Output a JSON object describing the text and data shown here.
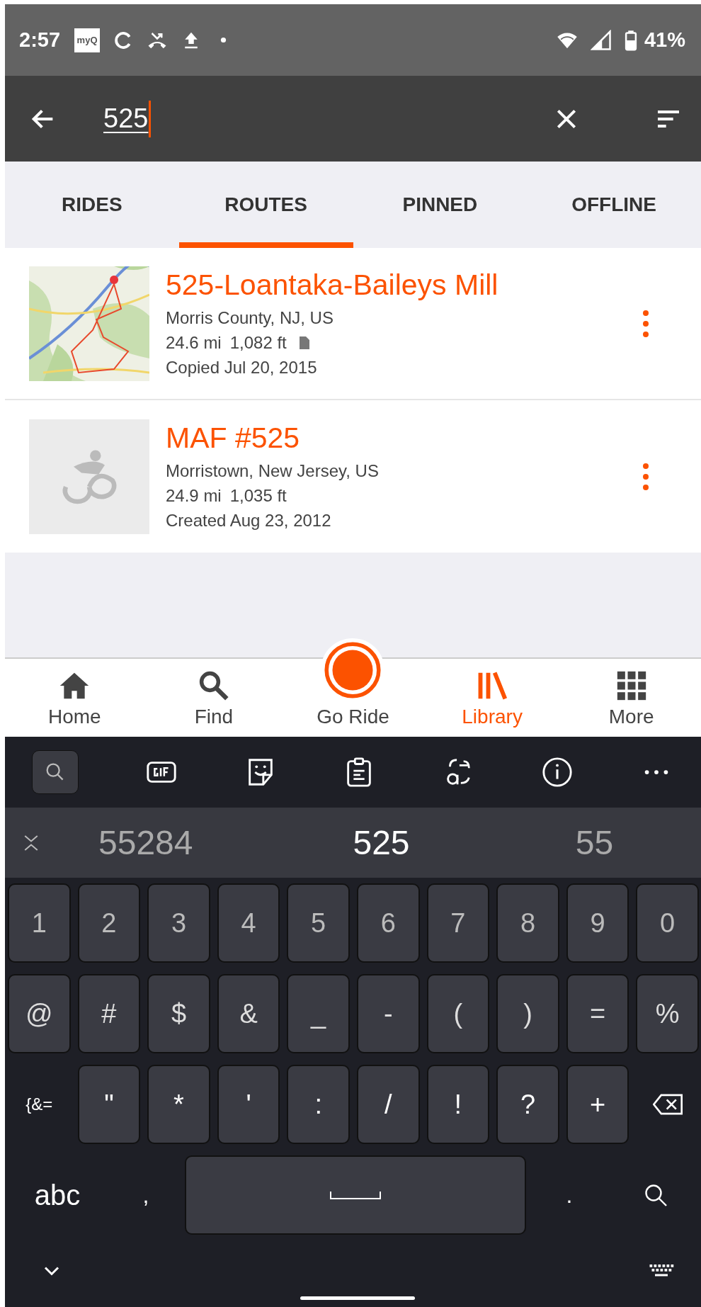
{
  "status_bar": {
    "time": "2:57",
    "app_badge": "myQ",
    "battery": "41%"
  },
  "search": {
    "value": "525"
  },
  "tabs": [
    {
      "label": "RIDES",
      "selected": false
    },
    {
      "label": "ROUTES",
      "selected": true
    },
    {
      "label": "PINNED",
      "selected": false
    },
    {
      "label": "OFFLINE",
      "selected": false
    }
  ],
  "routes": [
    {
      "kind": "picture",
      "title": "525-Loantaka-Baileys Mill",
      "location": "Morris County, NJ, US",
      "distance": "24.6 mi",
      "elevation": "1,082 ft",
      "attachment": true,
      "date": "Copied Jul 20, 2015"
    },
    {
      "kind": "placeholder",
      "title": "MAF #525",
      "location": "Morristown, New Jersey, US",
      "distance": "24.9 mi",
      "elevation": "1,035 ft",
      "attachment": false,
      "date": "Created Aug 23, 2012"
    }
  ],
  "bottom_nav": [
    {
      "kind": "home",
      "label": "Home",
      "selected": false
    },
    {
      "kind": "find",
      "label": "Find",
      "selected": false
    },
    {
      "kind": "record",
      "label": "Go Ride",
      "selected": false
    },
    {
      "kind": "library",
      "label": "Library",
      "selected": true
    },
    {
      "kind": "more",
      "label": "More",
      "selected": false
    }
  ],
  "keyboard": {
    "suggestions": [
      {
        "text": "55284",
        "selected": false
      },
      {
        "text": "525",
        "selected": true
      },
      {
        "text": "55",
        "selected": false
      }
    ],
    "rows": [
      [
        {
          "kind": "key",
          "label": "1"
        },
        {
          "kind": "key",
          "label": "2"
        },
        {
          "kind": "key",
          "label": "3"
        },
        {
          "kind": "key",
          "label": "4"
        },
        {
          "kind": "key",
          "label": "5"
        },
        {
          "kind": "key",
          "label": "6"
        },
        {
          "kind": "key",
          "label": "7"
        },
        {
          "kind": "key",
          "label": "8"
        },
        {
          "kind": "key",
          "label": "9"
        },
        {
          "kind": "key",
          "label": "0"
        }
      ],
      [
        {
          "kind": "key",
          "label": "@"
        },
        {
          "kind": "key",
          "label": "#"
        },
        {
          "kind": "key",
          "label": "$"
        },
        {
          "kind": "key",
          "label": "&"
        },
        {
          "kind": "key",
          "label": "_"
        },
        {
          "kind": "key",
          "label": "-"
        },
        {
          "kind": "key",
          "label": "("
        },
        {
          "kind": "key",
          "label": ")"
        },
        {
          "kind": "key",
          "label": "="
        },
        {
          "kind": "key",
          "label": "%"
        }
      ],
      [
        {
          "kind": "flat",
          "label": "{&="
        },
        {
          "kind": "key",
          "label": "\""
        },
        {
          "kind": "key",
          "label": "*"
        },
        {
          "kind": "key",
          "label": "'"
        },
        {
          "kind": "key",
          "label": ":"
        },
        {
          "kind": "key",
          "label": "/"
        },
        {
          "kind": "key",
          "label": "!"
        },
        {
          "kind": "key",
          "label": "?"
        },
        {
          "kind": "key",
          "label": "+"
        },
        {
          "kind": "backspace"
        }
      ]
    ],
    "bottom_row": [
      {
        "kind": "flat",
        "label": "abc"
      },
      {
        "kind": "flat",
        "label": ","
      },
      {
        "kind": "space"
      },
      {
        "kind": "flat",
        "label": "."
      },
      {
        "kind": "search"
      }
    ]
  }
}
